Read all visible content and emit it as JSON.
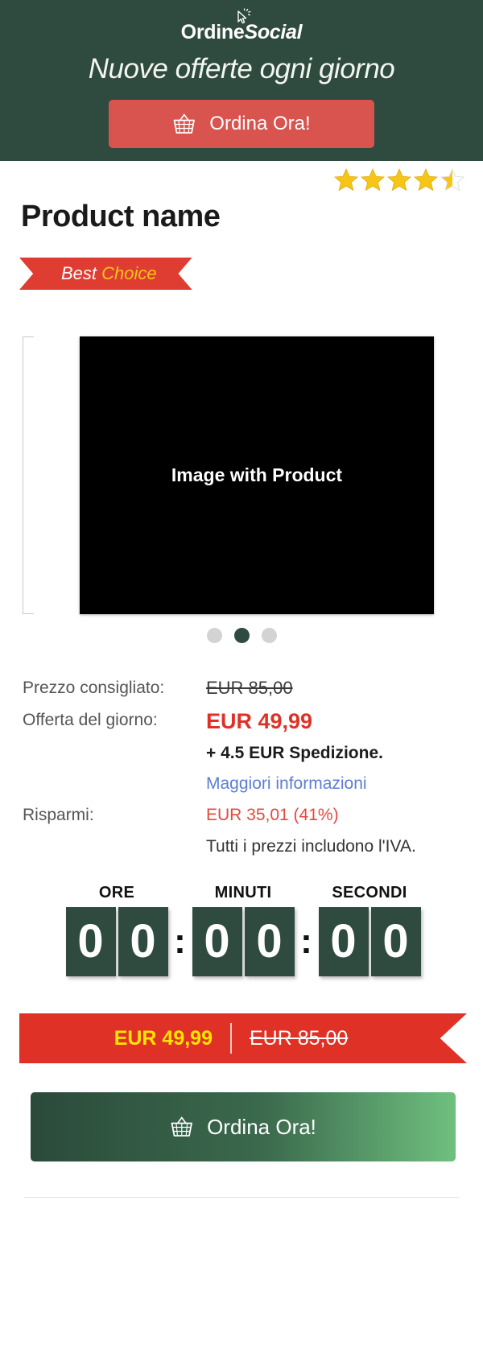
{
  "header": {
    "logo_primary": "Ordine",
    "logo_secondary": "Social",
    "logo_icon": "cursor-click-icon",
    "tagline": "Nuove offerte ogni giorno",
    "cta_label": "Ordina Ora!",
    "cta_icon": "shopping-basket-icon",
    "bg_color": "#2f4a3e",
    "cta_color": "#d9534f"
  },
  "product": {
    "name": "Product name",
    "rating": 4.5,
    "rating_max": 5,
    "star_color": "#f5c518",
    "star_empty_color": "#dddddd",
    "badge_prefix": "Best",
    "badge_suffix": "Choice",
    "badge_color": "#df3d32",
    "badge_prefix_color": "#ffffff",
    "badge_suffix_color": "#f5c518"
  },
  "gallery": {
    "image_placeholder_text": "Image with Product",
    "dots": [
      {
        "active": false
      },
      {
        "active": true
      },
      {
        "active": false
      }
    ]
  },
  "pricing": {
    "list_label": "Prezzo consigliato:",
    "list_value": "EUR 85,00",
    "deal_label": "Offerta del giorno:",
    "deal_value": "EUR 49,99",
    "shipping_note": "+ 4.5 EUR Spedizione.",
    "more_info_link": "Maggiori informazioni",
    "savings_label": "Risparmi:",
    "savings_value": "EUR 35,01 (41%)",
    "vat_note": "Tutti i prezzi includono l'IVA.",
    "deal_color": "#e03127",
    "link_color": "#5b7fd4"
  },
  "countdown": {
    "labels": [
      "ORE",
      "MINUTI",
      "SECONDI"
    ],
    "separator": ":",
    "hours": [
      "0",
      "0"
    ],
    "minutes": [
      "0",
      "0"
    ],
    "seconds": [
      "0",
      "0"
    ],
    "tile_color": "#2f4a3e"
  },
  "banner": {
    "new_price": "EUR 49,99",
    "old_price": "EUR 85,00",
    "bg_color": "#e03127",
    "new_price_color": "#ffe500"
  },
  "footer_cta": {
    "label": "Ordina Ora!",
    "icon": "shopping-basket-icon"
  }
}
